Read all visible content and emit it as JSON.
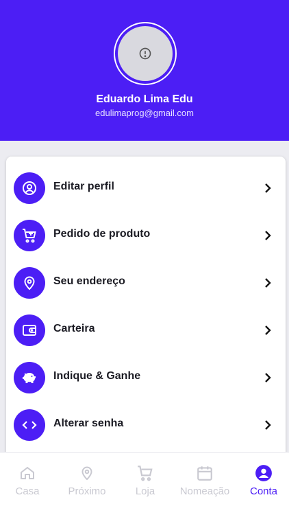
{
  "profile": {
    "name": "Eduardo Lima Edu",
    "email": "edulimaprog@gmail.com"
  },
  "menu": {
    "items": [
      {
        "label": "Editar perfil",
        "icon": "user-circle-icon"
      },
      {
        "label": "Pedido de produto",
        "icon": "cart-plus-icon"
      },
      {
        "label": "Seu endereço",
        "icon": "map-pin-icon"
      },
      {
        "label": "Carteira",
        "icon": "wallet-icon"
      },
      {
        "label": "Indique & Ganhe",
        "icon": "piggy-bank-icon"
      },
      {
        "label": "Alterar senha",
        "icon": "code-icon"
      }
    ]
  },
  "nav": {
    "items": [
      {
        "label": "Casa",
        "icon": "home-icon"
      },
      {
        "label": "Próximo",
        "icon": "map-pin-icon"
      },
      {
        "label": "Loja",
        "icon": "cart-icon"
      },
      {
        "label": "Nomeação",
        "icon": "calendar-icon"
      },
      {
        "label": "Conta",
        "icon": "account-icon"
      }
    ],
    "active": "Conta"
  },
  "colors": {
    "accent": "#4c1ef5",
    "inactive": "#c9c9d1",
    "background": "#ececf1"
  }
}
